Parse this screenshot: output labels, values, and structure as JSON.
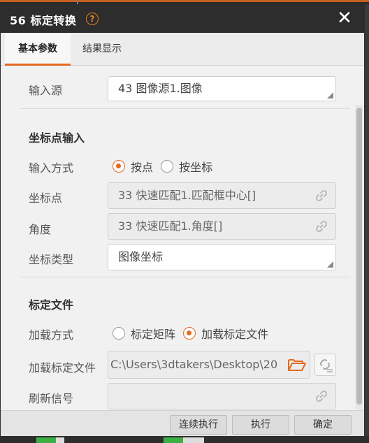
{
  "window": {
    "title": "56 标定转换",
    "help_icon": "?",
    "close_icon": "✕"
  },
  "tabs": [
    {
      "label": "基本参数",
      "active": true
    },
    {
      "label": "结果显示",
      "active": false
    }
  ],
  "fields": {
    "input_source": {
      "label": "输入源",
      "value": "43 图像源1.图像"
    },
    "coord_section": {
      "title": "坐标点输入"
    },
    "input_mode": {
      "label": "输入方式",
      "options": [
        "按点",
        "按坐标"
      ],
      "selected": "按点"
    },
    "coord_point": {
      "label": "坐标点",
      "value": "33 快速匹配1.匹配框中心[]"
    },
    "angle": {
      "label": "角度",
      "value": "33 快速匹配1.角度[]"
    },
    "coord_type": {
      "label": "坐标类型",
      "value": "图像坐标"
    },
    "calib_section": {
      "title": "标定文件"
    },
    "load_mode": {
      "label": "加载方式",
      "options": [
        "标定矩阵",
        "加载标定文件"
      ],
      "selected": "加载标定文件"
    },
    "calib_file": {
      "label": "加载标定文件",
      "value": "C:\\Users\\3dtakers\\Desktop\\20"
    },
    "refresh_signal": {
      "label": "刷新信号",
      "value": ""
    }
  },
  "footer": {
    "continuous_run": "连续执行",
    "run": "执行",
    "ok": "确定"
  },
  "colors": {
    "accent": "#e26a1f",
    "titlebar": "#2d2d2d"
  },
  "icons": {
    "help": "question-circle-icon",
    "close": "close-icon",
    "link": "link-icon",
    "folder": "folder-open-icon",
    "unlink": "unlink-icon"
  }
}
